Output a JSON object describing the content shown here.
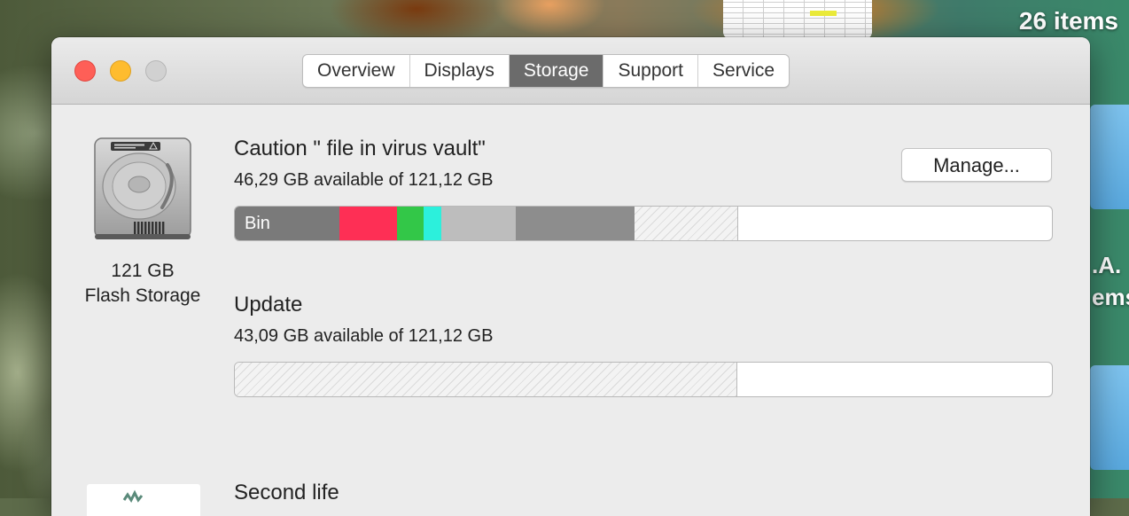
{
  "desktop": {
    "item_count": "26 items",
    "partial_label_1": ".A.",
    "partial_label_2": "ems"
  },
  "window": {
    "tabs": [
      {
        "label": "Overview",
        "active": false
      },
      {
        "label": "Displays",
        "active": false
      },
      {
        "label": "Storage",
        "active": true
      },
      {
        "label": "Support",
        "active": false
      },
      {
        "label": "Service",
        "active": false
      }
    ]
  },
  "disk": {
    "capacity": "121 GB",
    "type": "Flash Storage",
    "icon": "hard-drive-icon"
  },
  "volumes": [
    {
      "title": "Caution \" file in virus vault\"",
      "available": "46,29 GB available of 121,12 GB",
      "manage_label": "Manage...",
      "segments": [
        {
          "label": "Bin",
          "color": "#7a7a7a",
          "fraction": 0.128
        },
        {
          "label": "",
          "color": "#fe2f55",
          "fraction": 0.071
        },
        {
          "label": "",
          "color": "#33c748",
          "fraction": 0.032
        },
        {
          "label": "",
          "color": "#2cf0dc",
          "fraction": 0.022
        },
        {
          "label": "",
          "color": "#bdbdbd",
          "fraction": 0.091
        },
        {
          "label": "",
          "color": "#8d8d8d",
          "fraction": 0.145
        },
        {
          "label": "",
          "color": "hatched",
          "fraction": 0.127
        }
      ]
    },
    {
      "title": "Update",
      "available": "43,09 GB available of 121,12 GB",
      "segments": [
        {
          "label": "",
          "color": "hatched",
          "fraction": 0.615
        }
      ]
    },
    {
      "title": "Second life"
    }
  ]
}
